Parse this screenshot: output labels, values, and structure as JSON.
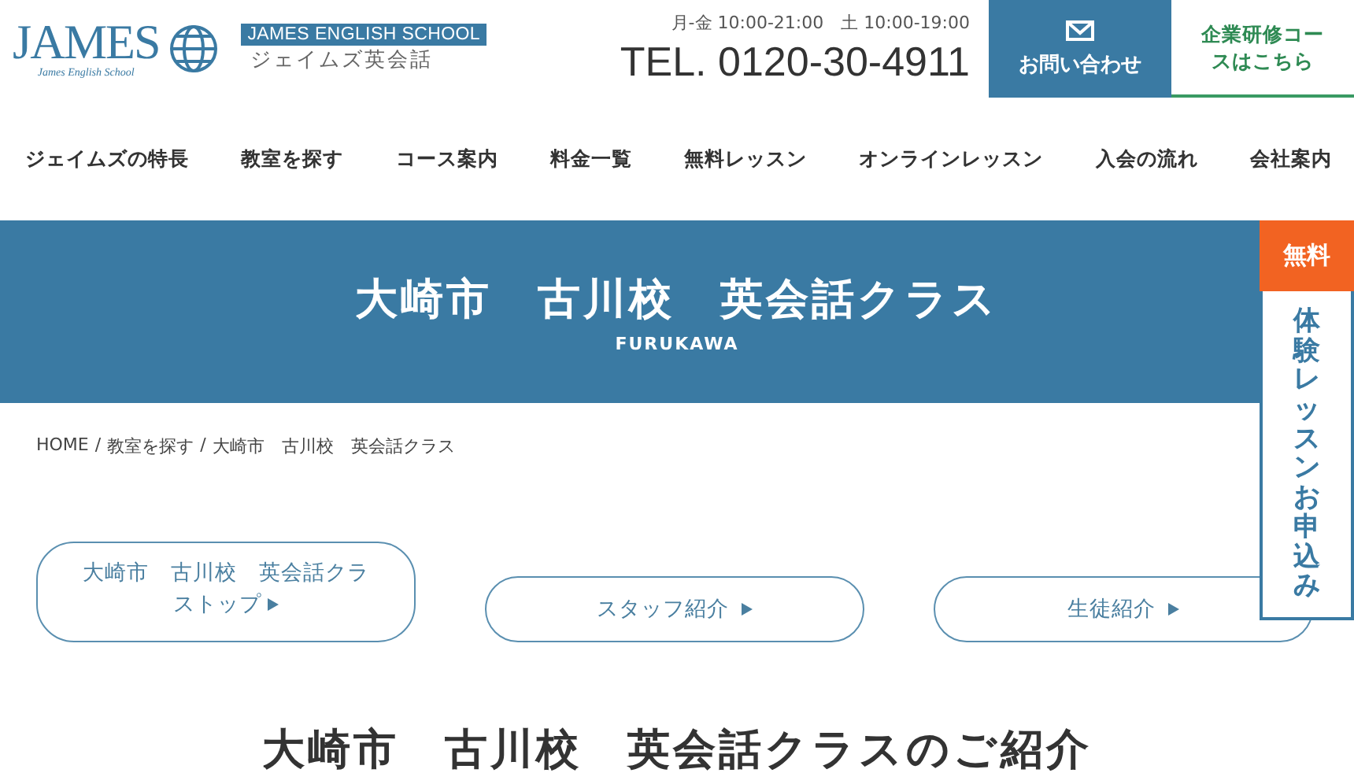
{
  "header": {
    "logo_text": "JAMES",
    "logo_subtext": "James English School",
    "school_name_en": "JAMES ENGLISH SCHOOL",
    "school_name_ja": "ジェイムズ英会話",
    "hours": "月-金 10:00-21:00　土 10:00-19:00",
    "phone": "TEL. 0120-30-4911",
    "contact_button": "お問い合わせ",
    "corporate_button": "企業研修コースはこちら"
  },
  "nav": [
    "ジェイムズの特長",
    "教室を探す",
    "コース案内",
    "料金一覧",
    "無料レッスン",
    "オンラインレッスン",
    "入会の流れ",
    "会社案内"
  ],
  "banner": {
    "title": "大崎市　古川校　英会話クラス",
    "subtitle": "FURUKAWA"
  },
  "side_tab": {
    "badge": "無料",
    "label": "体験レッスンお申込み"
  },
  "breadcrumb_separator": "/",
  "breadcrumb": [
    "HOME",
    "教室を探す",
    "大崎市　古川校　英会話クラス"
  ],
  "sub_nav": [
    "大崎市　古川校　英会話クラストップ",
    "スタッフ紹介",
    "生徒紹介"
  ],
  "section_title": "大崎市　古川校　英会話クラスのご紹介"
}
